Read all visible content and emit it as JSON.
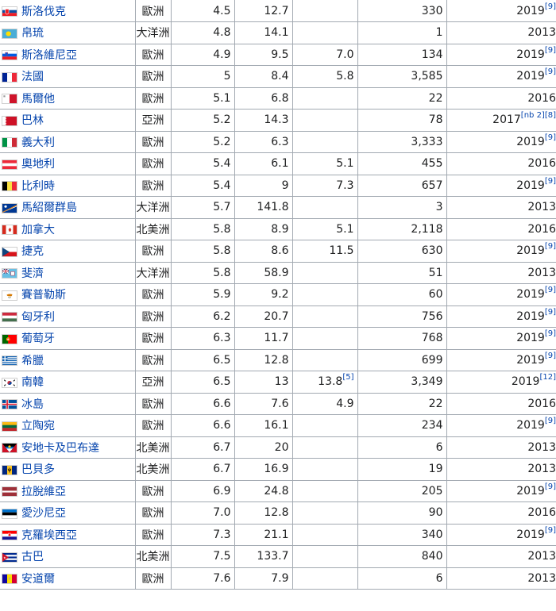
{
  "rows": [
    {
      "country": "斯洛伐克",
      "flag": "slovakia",
      "region": "歐洲",
      "c1": "4.5",
      "c2": "12.7",
      "c3": "",
      "c3_ref": "",
      "c4": "330",
      "year": "2019",
      "year_ref": "[9]"
    },
    {
      "country": "帛琉",
      "flag": "palau",
      "region": "大洋洲",
      "c1": "4.8",
      "c2": "14.1",
      "c3": "",
      "c3_ref": "",
      "c4": "1",
      "year": "2013",
      "year_ref": ""
    },
    {
      "country": "斯洛維尼亞",
      "flag": "slovenia",
      "region": "歐洲",
      "c1": "4.9",
      "c2": "9.5",
      "c3": "7.0",
      "c3_ref": "",
      "c4": "134",
      "year": "2019",
      "year_ref": "[9]"
    },
    {
      "country": "法國",
      "flag": "france",
      "region": "歐洲",
      "c1": "5",
      "c2": "8.4",
      "c3": "5.8",
      "c3_ref": "",
      "c4": "3,585",
      "year": "2019",
      "year_ref": "[9]"
    },
    {
      "country": "馬爾他",
      "flag": "malta",
      "region": "歐洲",
      "c1": "5.1",
      "c2": "6.8",
      "c3": "",
      "c3_ref": "",
      "c4": "22",
      "year": "2016",
      "year_ref": ""
    },
    {
      "country": "巴林",
      "flag": "bahrain",
      "region": "亞洲",
      "c1": "5.2",
      "c2": "14.3",
      "c3": "",
      "c3_ref": "",
      "c4": "78",
      "year": "2017",
      "year_ref": "[nb 2][8]"
    },
    {
      "country": "義大利",
      "flag": "italy",
      "region": "歐洲",
      "c1": "5.2",
      "c2": "6.3",
      "c3": "",
      "c3_ref": "",
      "c4": "3,333",
      "year": "2019",
      "year_ref": "[9]"
    },
    {
      "country": "奧地利",
      "flag": "austria",
      "region": "歐洲",
      "c1": "5.4",
      "c2": "6.1",
      "c3": "5.1",
      "c3_ref": "",
      "c4": "455",
      "year": "2016",
      "year_ref": ""
    },
    {
      "country": "比利時",
      "flag": "belgium",
      "region": "歐洲",
      "c1": "5.4",
      "c2": "9",
      "c3": "7.3",
      "c3_ref": "",
      "c4": "657",
      "year": "2019",
      "year_ref": "[9]"
    },
    {
      "country": "馬紹爾群島",
      "flag": "marshall",
      "region": "大洋洲",
      "c1": "5.7",
      "c2": "141.8",
      "c3": "",
      "c3_ref": "",
      "c4": "3",
      "year": "2013",
      "year_ref": ""
    },
    {
      "country": "加拿大",
      "flag": "canada",
      "region": "北美洲",
      "c1": "5.8",
      "c2": "8.9",
      "c3": "5.1",
      "c3_ref": "",
      "c4": "2,118",
      "year": "2016",
      "year_ref": ""
    },
    {
      "country": "捷克",
      "flag": "czech",
      "region": "歐洲",
      "c1": "5.8",
      "c2": "8.6",
      "c3": "11.5",
      "c3_ref": "",
      "c4": "630",
      "year": "2019",
      "year_ref": "[9]"
    },
    {
      "country": "斐濟",
      "flag": "fiji",
      "region": "大洋洲",
      "c1": "5.8",
      "c2": "58.9",
      "c3": "",
      "c3_ref": "",
      "c4": "51",
      "year": "2013",
      "year_ref": ""
    },
    {
      "country": "賽普勒斯",
      "flag": "cyprus",
      "region": "歐洲",
      "c1": "5.9",
      "c2": "9.2",
      "c3": "",
      "c3_ref": "",
      "c4": "60",
      "year": "2019",
      "year_ref": "[9]"
    },
    {
      "country": "匈牙利",
      "flag": "hungary",
      "region": "歐洲",
      "c1": "6.2",
      "c2": "20.7",
      "c3": "",
      "c3_ref": "",
      "c4": "756",
      "year": "2019",
      "year_ref": "[9]"
    },
    {
      "country": "葡萄牙",
      "flag": "portugal",
      "region": "歐洲",
      "c1": "6.3",
      "c2": "11.7",
      "c3": "",
      "c3_ref": "",
      "c4": "768",
      "year": "2019",
      "year_ref": "[9]"
    },
    {
      "country": "希臘",
      "flag": "greece",
      "region": "歐洲",
      "c1": "6.5",
      "c2": "12.8",
      "c3": "",
      "c3_ref": "",
      "c4": "699",
      "year": "2019",
      "year_ref": "[9]"
    },
    {
      "country": "南韓",
      "flag": "southkorea",
      "region": "亞洲",
      "c1": "6.5",
      "c2": "13",
      "c3": "13.8",
      "c3_ref": "[5]",
      "c4": "3,349",
      "year": "2019",
      "year_ref": "[12]"
    },
    {
      "country": "冰島",
      "flag": "iceland",
      "region": "歐洲",
      "c1": "6.6",
      "c2": "7.6",
      "c3": "4.9",
      "c3_ref": "",
      "c4": "22",
      "year": "2016",
      "year_ref": ""
    },
    {
      "country": "立陶宛",
      "flag": "lithuania",
      "region": "歐洲",
      "c1": "6.6",
      "c2": "16.1",
      "c3": "",
      "c3_ref": "",
      "c4": "234",
      "year": "2019",
      "year_ref": "[9]"
    },
    {
      "country": "安地卡及巴布達",
      "flag": "antigua",
      "region": "北美洲",
      "c1": "6.7",
      "c2": "20",
      "c3": "",
      "c3_ref": "",
      "c4": "6",
      "year": "2013",
      "year_ref": ""
    },
    {
      "country": "巴貝多",
      "flag": "barbados",
      "region": "北美洲",
      "c1": "6.7",
      "c2": "16.9",
      "c3": "",
      "c3_ref": "",
      "c4": "19",
      "year": "2013",
      "year_ref": ""
    },
    {
      "country": "拉脫維亞",
      "flag": "latvia",
      "region": "歐洲",
      "c1": "6.9",
      "c2": "24.8",
      "c3": "",
      "c3_ref": "",
      "c4": "205",
      "year": "2019",
      "year_ref": "[9]"
    },
    {
      "country": "愛沙尼亞",
      "flag": "estonia",
      "region": "歐洲",
      "c1": "7.0",
      "c2": "12.8",
      "c3": "",
      "c3_ref": "",
      "c4": "90",
      "year": "2016",
      "year_ref": ""
    },
    {
      "country": "克羅埃西亞",
      "flag": "croatia",
      "region": "歐洲",
      "c1": "7.3",
      "c2": "21.1",
      "c3": "",
      "c3_ref": "",
      "c4": "340",
      "year": "2019",
      "year_ref": "[9]"
    },
    {
      "country": "古巴",
      "flag": "cuba",
      "region": "北美洲",
      "c1": "7.5",
      "c2": "133.7",
      "c3": "",
      "c3_ref": "",
      "c4": "840",
      "year": "2013",
      "year_ref": ""
    },
    {
      "country": "安道爾",
      "flag": "andorra",
      "region": "歐洲",
      "c1": "7.6",
      "c2": "7.9",
      "c3": "",
      "c3_ref": "",
      "c4": "6",
      "year": "2013",
      "year_ref": ""
    }
  ]
}
